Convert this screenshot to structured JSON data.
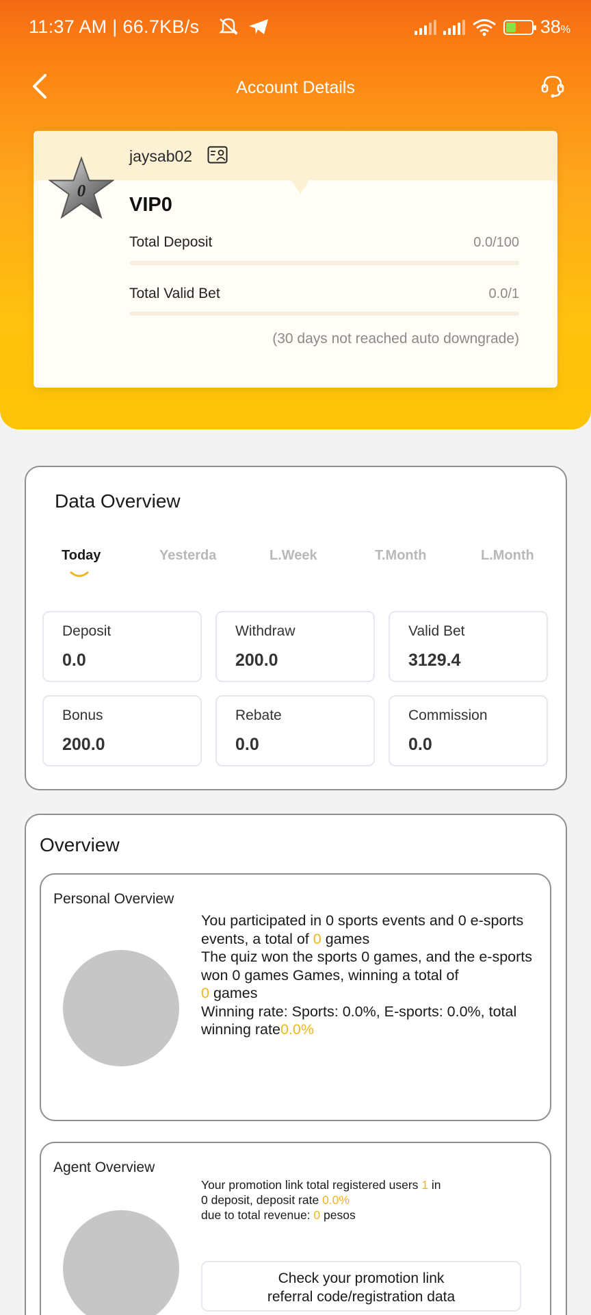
{
  "status_bar": {
    "time": "11:37 AM | 66.7KB/s",
    "battery": "38",
    "battery_unit": "%"
  },
  "header": {
    "title": "Account Details"
  },
  "vip": {
    "username": "jaysab02",
    "level": "VIP0",
    "badge_digit": "0",
    "total_deposit_label": "Total Deposit",
    "total_deposit_value": "0.0/100",
    "total_deposit_progress": 0,
    "total_valid_bet_label": "Total Valid Bet",
    "total_valid_bet_value": "0.0/1",
    "total_valid_bet_progress": 0,
    "downgrade_note": "(30 days not reached auto downgrade)"
  },
  "data_overview": {
    "title": "Data Overview",
    "tabs": [
      {
        "label": "Today",
        "active": true
      },
      {
        "label": "Yesterda",
        "active": false
      },
      {
        "label": "L.Week",
        "active": false
      },
      {
        "label": "T.Month",
        "active": false
      },
      {
        "label": "L.Month",
        "active": false
      }
    ],
    "stats": [
      {
        "label": "Deposit",
        "value": "0.0"
      },
      {
        "label": "Withdraw",
        "value": "200.0"
      },
      {
        "label": "Valid Bet",
        "value": "3129.4"
      },
      {
        "label": "Bonus",
        "value": "200.0"
      },
      {
        "label": "Rebate",
        "value": "0.0"
      },
      {
        "label": "Commission",
        "value": "0.0"
      }
    ]
  },
  "overview": {
    "title": "Overview",
    "personal": {
      "title": "Personal Overview",
      "text_1": "You participated in 0 sports events and 0 e-sports events, a total of ",
      "total_games": "0",
      "text_2": " games",
      "text_3": "The quiz won the sports 0 games, and the e-sports won 0 games Games, winning a total of ",
      "won_games": "0",
      "text_4": " games",
      "text_5": "Winning rate: Sports: 0.0%, E-sports: 0.0%, total winning rate",
      "total_rate": "0.0%"
    },
    "agent": {
      "title": "Agent Overview",
      "text_1": "Your promotion link total registered users ",
      "registered": "1",
      "text_2": " in",
      "text_3": "0 deposit, deposit rate ",
      "deposit_rate": "0.0%",
      "text_4": "due to total revenue: ",
      "revenue": "0",
      "text_5": " pesos",
      "button_line_1": "Check your promotion link",
      "button_line_2": "referral code/registration data"
    }
  },
  "colors": {
    "accent": "#f1b51e",
    "header_top": "#f46a14",
    "header_bottom": "#fdc306"
  }
}
